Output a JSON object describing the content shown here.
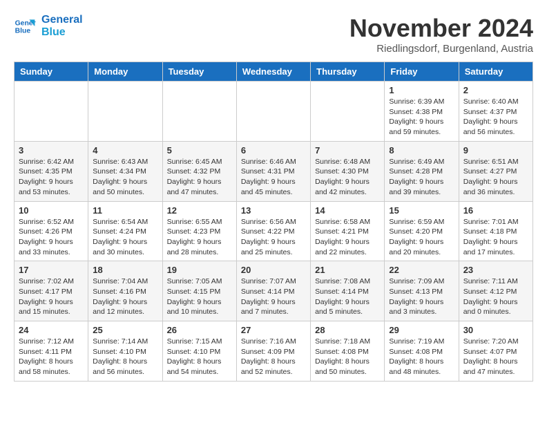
{
  "header": {
    "logo_line1": "General",
    "logo_line2": "Blue",
    "month": "November 2024",
    "location": "Riedlingsdorf, Burgenland, Austria"
  },
  "days_of_week": [
    "Sunday",
    "Monday",
    "Tuesday",
    "Wednesday",
    "Thursday",
    "Friday",
    "Saturday"
  ],
  "weeks": [
    [
      {
        "day": "",
        "info": ""
      },
      {
        "day": "",
        "info": ""
      },
      {
        "day": "",
        "info": ""
      },
      {
        "day": "",
        "info": ""
      },
      {
        "day": "",
        "info": ""
      },
      {
        "day": "1",
        "info": "Sunrise: 6:39 AM\nSunset: 4:38 PM\nDaylight: 9 hours and 59 minutes."
      },
      {
        "day": "2",
        "info": "Sunrise: 6:40 AM\nSunset: 4:37 PM\nDaylight: 9 hours and 56 minutes."
      }
    ],
    [
      {
        "day": "3",
        "info": "Sunrise: 6:42 AM\nSunset: 4:35 PM\nDaylight: 9 hours and 53 minutes."
      },
      {
        "day": "4",
        "info": "Sunrise: 6:43 AM\nSunset: 4:34 PM\nDaylight: 9 hours and 50 minutes."
      },
      {
        "day": "5",
        "info": "Sunrise: 6:45 AM\nSunset: 4:32 PM\nDaylight: 9 hours and 47 minutes."
      },
      {
        "day": "6",
        "info": "Sunrise: 6:46 AM\nSunset: 4:31 PM\nDaylight: 9 hours and 45 minutes."
      },
      {
        "day": "7",
        "info": "Sunrise: 6:48 AM\nSunset: 4:30 PM\nDaylight: 9 hours and 42 minutes."
      },
      {
        "day": "8",
        "info": "Sunrise: 6:49 AM\nSunset: 4:28 PM\nDaylight: 9 hours and 39 minutes."
      },
      {
        "day": "9",
        "info": "Sunrise: 6:51 AM\nSunset: 4:27 PM\nDaylight: 9 hours and 36 minutes."
      }
    ],
    [
      {
        "day": "10",
        "info": "Sunrise: 6:52 AM\nSunset: 4:26 PM\nDaylight: 9 hours and 33 minutes."
      },
      {
        "day": "11",
        "info": "Sunrise: 6:54 AM\nSunset: 4:24 PM\nDaylight: 9 hours and 30 minutes."
      },
      {
        "day": "12",
        "info": "Sunrise: 6:55 AM\nSunset: 4:23 PM\nDaylight: 9 hours and 28 minutes."
      },
      {
        "day": "13",
        "info": "Sunrise: 6:56 AM\nSunset: 4:22 PM\nDaylight: 9 hours and 25 minutes."
      },
      {
        "day": "14",
        "info": "Sunrise: 6:58 AM\nSunset: 4:21 PM\nDaylight: 9 hours and 22 minutes."
      },
      {
        "day": "15",
        "info": "Sunrise: 6:59 AM\nSunset: 4:20 PM\nDaylight: 9 hours and 20 minutes."
      },
      {
        "day": "16",
        "info": "Sunrise: 7:01 AM\nSunset: 4:18 PM\nDaylight: 9 hours and 17 minutes."
      }
    ],
    [
      {
        "day": "17",
        "info": "Sunrise: 7:02 AM\nSunset: 4:17 PM\nDaylight: 9 hours and 15 minutes."
      },
      {
        "day": "18",
        "info": "Sunrise: 7:04 AM\nSunset: 4:16 PM\nDaylight: 9 hours and 12 minutes."
      },
      {
        "day": "19",
        "info": "Sunrise: 7:05 AM\nSunset: 4:15 PM\nDaylight: 9 hours and 10 minutes."
      },
      {
        "day": "20",
        "info": "Sunrise: 7:07 AM\nSunset: 4:14 PM\nDaylight: 9 hours and 7 minutes."
      },
      {
        "day": "21",
        "info": "Sunrise: 7:08 AM\nSunset: 4:14 PM\nDaylight: 9 hours and 5 minutes."
      },
      {
        "day": "22",
        "info": "Sunrise: 7:09 AM\nSunset: 4:13 PM\nDaylight: 9 hours and 3 minutes."
      },
      {
        "day": "23",
        "info": "Sunrise: 7:11 AM\nSunset: 4:12 PM\nDaylight: 9 hours and 0 minutes."
      }
    ],
    [
      {
        "day": "24",
        "info": "Sunrise: 7:12 AM\nSunset: 4:11 PM\nDaylight: 8 hours and 58 minutes."
      },
      {
        "day": "25",
        "info": "Sunrise: 7:14 AM\nSunset: 4:10 PM\nDaylight: 8 hours and 56 minutes."
      },
      {
        "day": "26",
        "info": "Sunrise: 7:15 AM\nSunset: 4:10 PM\nDaylight: 8 hours and 54 minutes."
      },
      {
        "day": "27",
        "info": "Sunrise: 7:16 AM\nSunset: 4:09 PM\nDaylight: 8 hours and 52 minutes."
      },
      {
        "day": "28",
        "info": "Sunrise: 7:18 AM\nSunset: 4:08 PM\nDaylight: 8 hours and 50 minutes."
      },
      {
        "day": "29",
        "info": "Sunrise: 7:19 AM\nSunset: 4:08 PM\nDaylight: 8 hours and 48 minutes."
      },
      {
        "day": "30",
        "info": "Sunrise: 7:20 AM\nSunset: 4:07 PM\nDaylight: 8 hours and 47 minutes."
      }
    ]
  ]
}
